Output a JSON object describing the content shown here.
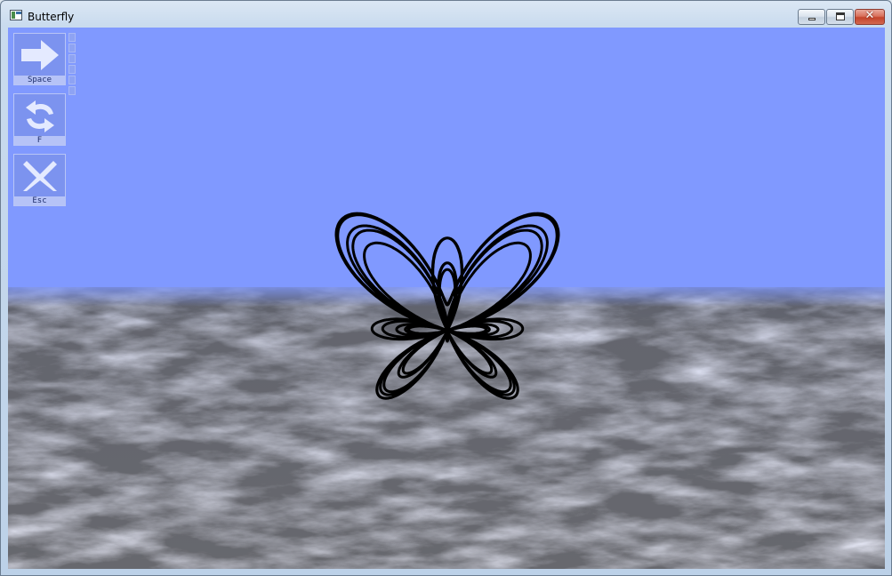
{
  "window": {
    "title": "Butterfly"
  },
  "titlebar": {
    "icon": "app-window-icon",
    "buttons": [
      {
        "name": "minimize",
        "icon": "minimize-icon"
      },
      {
        "name": "maximize",
        "icon": "maximize-icon"
      },
      {
        "name": "close",
        "icon": "close-icon",
        "glyph": "✕"
      }
    ]
  },
  "controls": [
    {
      "key_label": "Space",
      "icon": "arrow-right-icon"
    },
    {
      "key_label": "F",
      "icon": "refresh-arrows-icon"
    },
    {
      "key_label": "Esc",
      "icon": "close-x-icon"
    }
  ],
  "colors": {
    "sky": "#8099ff",
    "curve": "#000000",
    "panel": "#7c93ef",
    "panel_label": "#b6c3f7",
    "close_button": "#c4432b"
  }
}
